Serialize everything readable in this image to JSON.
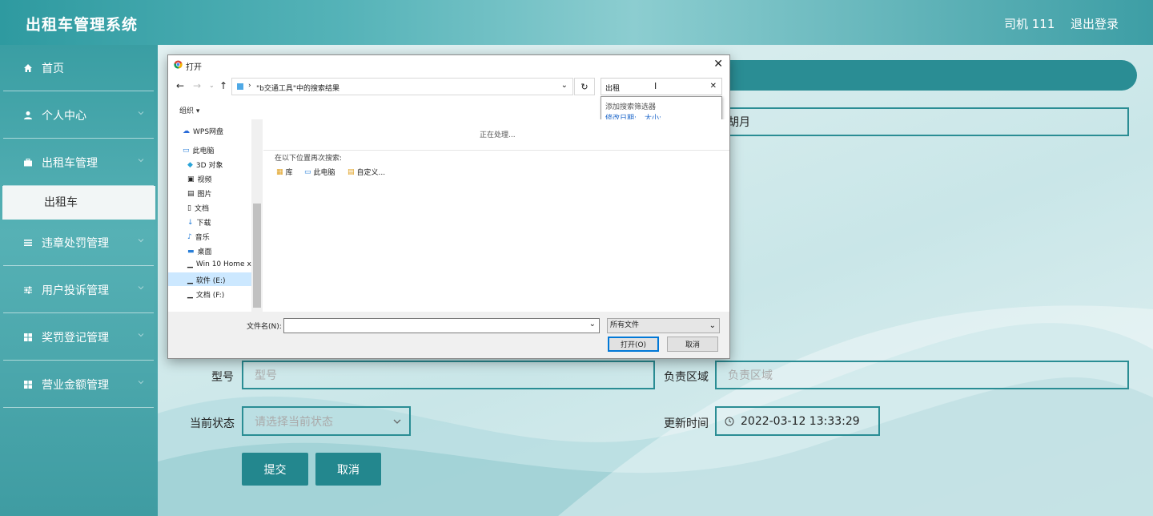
{
  "header": {
    "app_title": "出租车管理系统",
    "user_label": "司机 111",
    "logout_label": "退出登录"
  },
  "sidebar": {
    "items": [
      {
        "label": "首页",
        "icon": "home-icon"
      },
      {
        "label": "个人中心",
        "icon": "user-icon"
      },
      {
        "label": "出租车管理",
        "icon": "briefcase-icon"
      },
      {
        "label": "违章处罚管理",
        "icon": "list-icon"
      },
      {
        "label": "用户投诉管理",
        "icon": "sliders-icon"
      },
      {
        "label": "奖罚登记管理",
        "icon": "grid-icon"
      },
      {
        "label": "营业金额管理",
        "icon": "grid-icon"
      }
    ],
    "active_sub": "出租车"
  },
  "form": {
    "driver_name_value": "胡月",
    "model_label": "型号",
    "model_placeholder": "型号",
    "area_label": "负责区域",
    "area_placeholder": "负责区域",
    "status_label": "当前状态",
    "status_placeholder": "请选择当前状态",
    "update_label": "更新时间",
    "update_value": "2022-03-12 13:33:29",
    "submit_label": "提交",
    "cancel_label": "取消"
  },
  "dialog": {
    "title": "打开",
    "address": "\"b交通工具\"中的搜索结果",
    "search_value": "出租",
    "suggest_title": "添加搜索筛选器",
    "suggest_date": "修改日期:",
    "suggest_size": "大小:",
    "organize_label": "组织 ▾",
    "nav_items": [
      "WPS网盘",
      "此电脑",
      "3D 对象",
      "视频",
      "图片",
      "文档",
      "下载",
      "音乐",
      "桌面",
      "Win 10 Home x",
      "软件 (E:)",
      "文档 (F:)"
    ],
    "processing": "正在处理...",
    "search_again": "在以下位置再次搜索:",
    "locations": [
      "库",
      "此电脑",
      "自定义..."
    ],
    "filename_label": "文件名(N):",
    "filetype": "所有文件",
    "open_label": "打开(O)",
    "cancel_label": "取消"
  },
  "colors": {
    "teal_dark": "#23878e",
    "teal": "#2a8d94",
    "header_light": "#8ccdd0"
  }
}
